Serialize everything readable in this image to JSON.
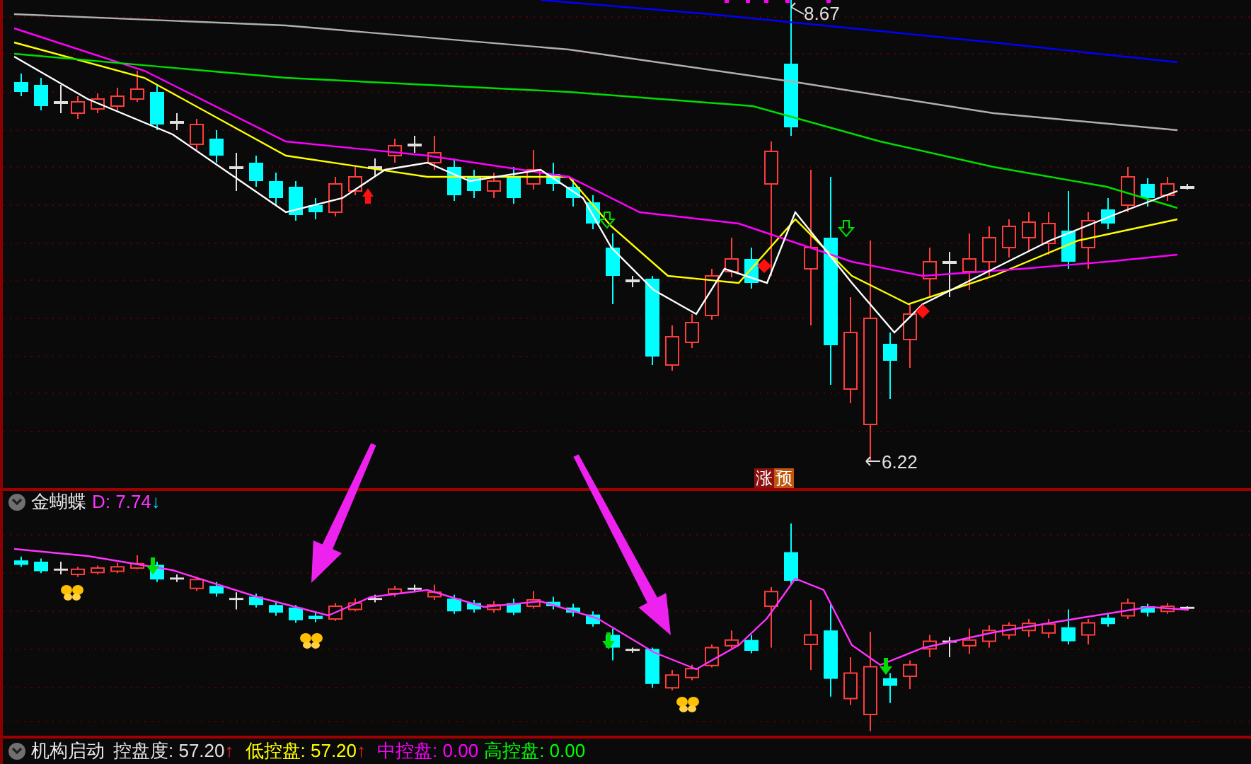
{
  "price_chart": {
    "high_label": "8.67",
    "low_label": "6.22",
    "signal_badges": [
      {
        "text": "涨",
        "color": "#8b1010"
      },
      {
        "text": "预",
        "color": "#c0560e"
      }
    ]
  },
  "indicator_panel": {
    "name": "金蝴蝶",
    "reading": "D: 7.74",
    "trend_arrow": "↓"
  },
  "status_panel": {
    "name": "机构启动",
    "readings": [
      {
        "label": "控盘度: 57.20",
        "arrow": "↑",
        "color": "#e0e0e0"
      },
      {
        "label": "低控盘: 57.20",
        "arrow": "↑",
        "color": "#ffff00"
      },
      {
        "label": "中控盘: 0.00",
        "color": "#ff00ff"
      },
      {
        "label": "高控盘: 0.00",
        "color": "#00ff00"
      }
    ]
  }
}
